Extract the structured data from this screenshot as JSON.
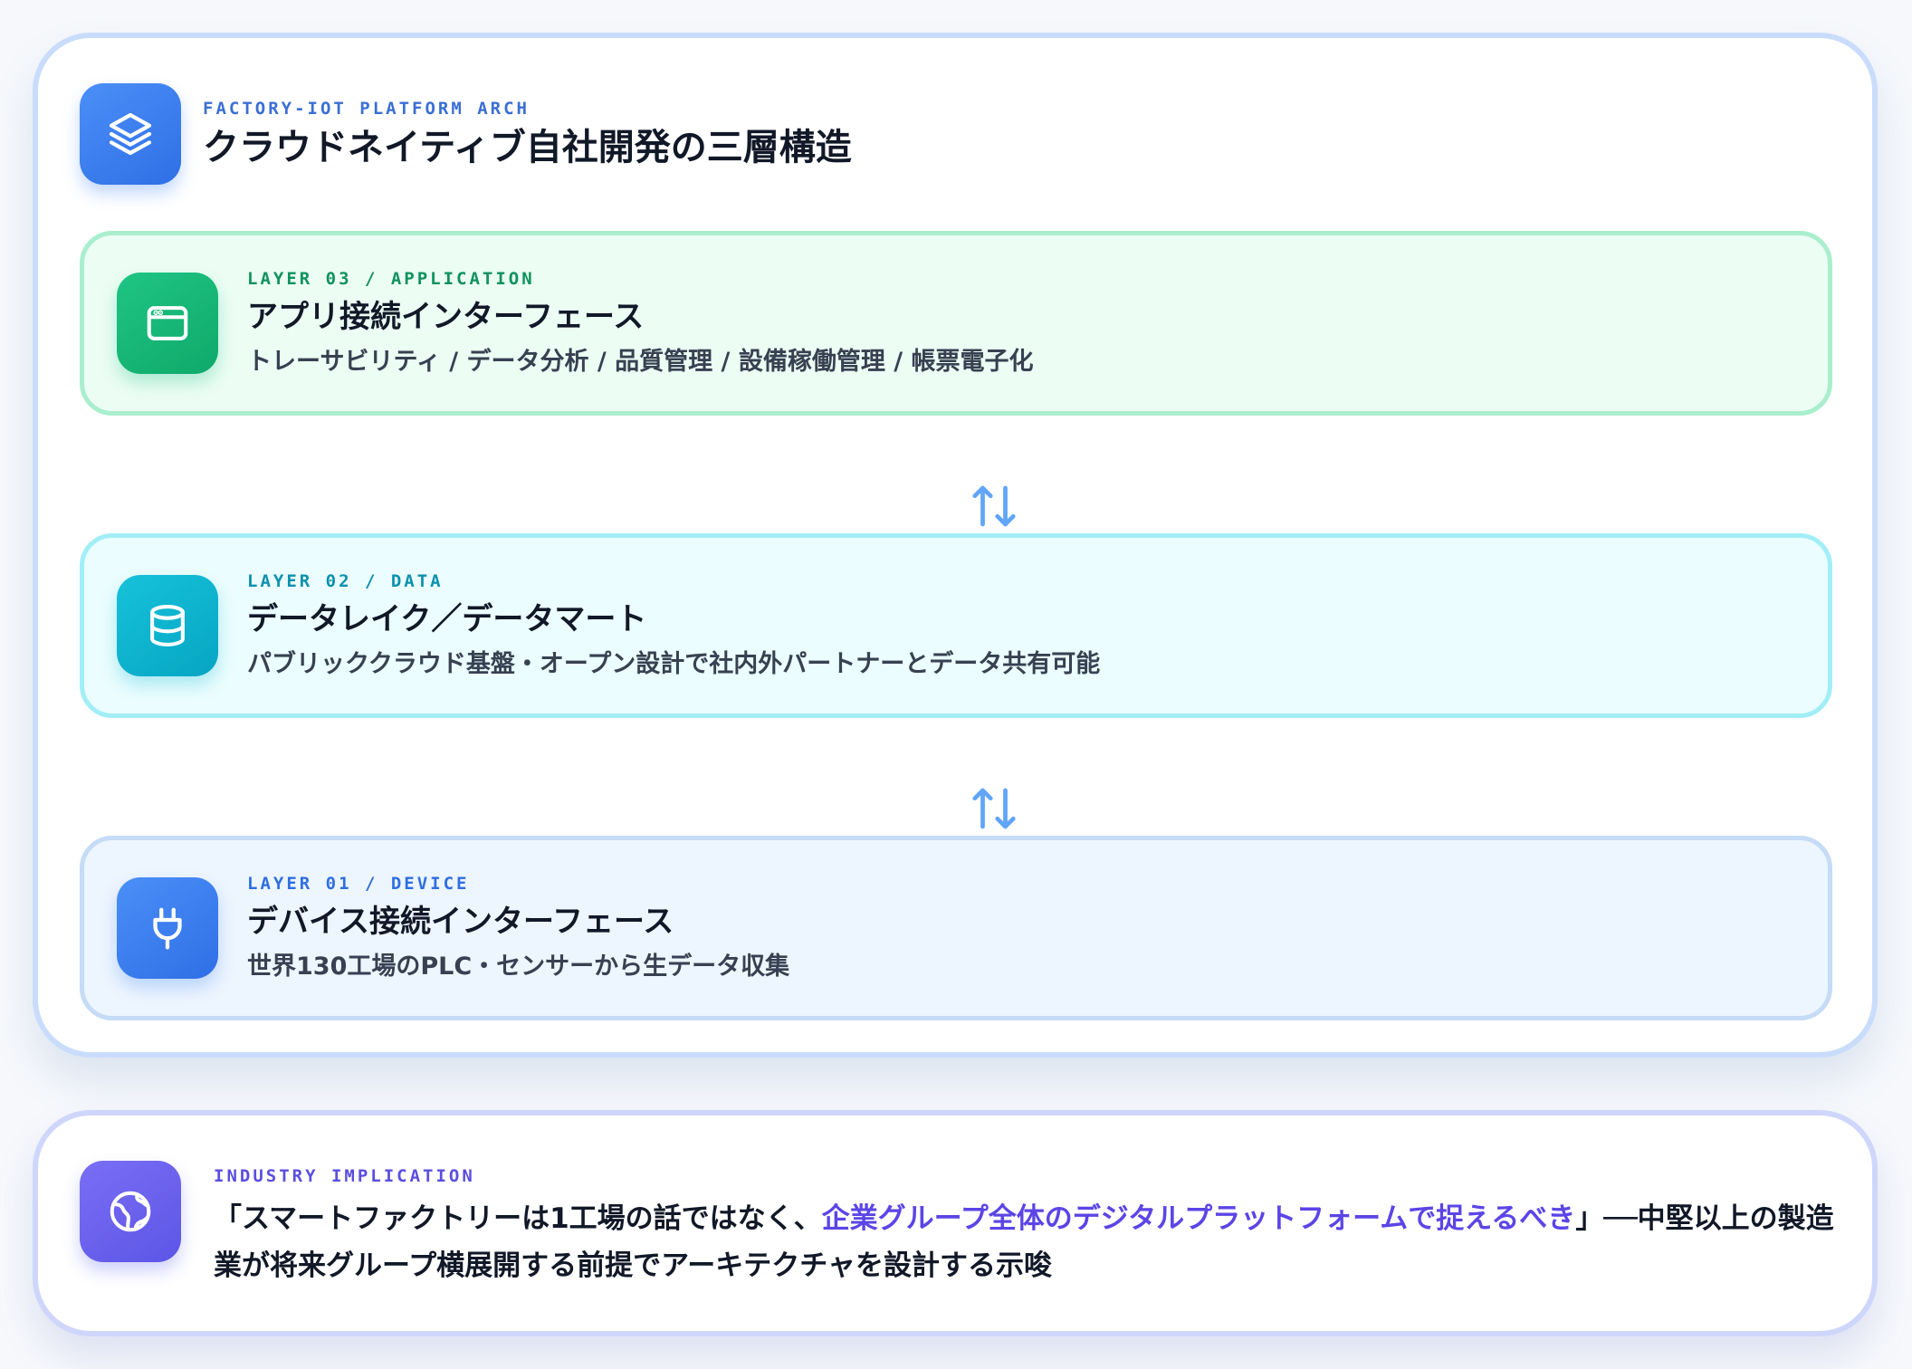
{
  "header": {
    "eyebrow": "FACTORY-IOT PLATFORM ARCH",
    "title": "クラウドネイティブ自社開発の三層構造",
    "icon": "layers-icon"
  },
  "layers": [
    {
      "eyebrow": "LAYER 03 / APPLICATION",
      "title": "アプリ接続インターフェース",
      "desc": "トレーサビリティ / データ分析 / 品質管理 / 設備稼働管理 / 帳票電子化",
      "icon": "app-window-icon",
      "accent": "#10b981"
    },
    {
      "eyebrow": "LAYER 02 / DATA",
      "title": "データレイク／データマート",
      "desc": "パブリッククラウド基盤・オープン設計で社内外パートナーとデータ共有可能",
      "icon": "database-icon",
      "accent": "#06b6d4"
    },
    {
      "eyebrow": "LAYER 01 / DEVICE",
      "title": "デバイス接続インターフェース",
      "desc": "世界130工場のPLC・センサーから生データ収集",
      "icon": "plug-icon",
      "accent": "#3b82f6"
    }
  ],
  "connectors": {
    "icon": "arrows-up-down-icon",
    "color": "#60a5fa"
  },
  "implication": {
    "eyebrow": "INDUSTRY IMPLICATION",
    "text_before": "「スマートファクトリーは1工場の話ではなく、",
    "text_highlight": "企業グループ全体のデジタルプラットフォームで捉えるべき",
    "text_after": "」──中堅以上の製造業が将来グループ横展開する前提でアーキテクチャを設計する示唆",
    "icon": "globe-icon",
    "highlight_color": "#5b45e6"
  }
}
